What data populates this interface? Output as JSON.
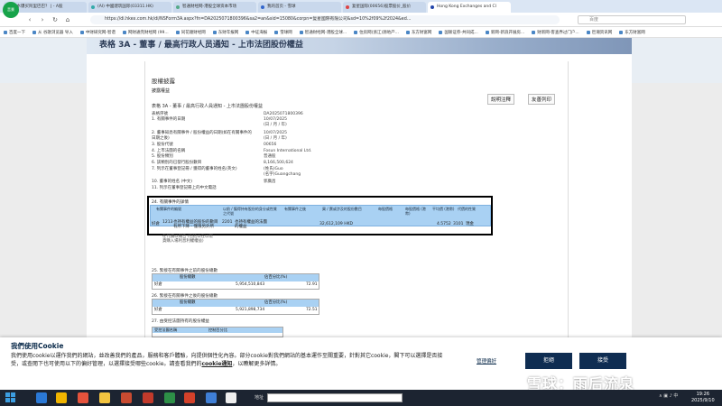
{
  "browser": {
    "badge": "音景",
    "tabs": [
      "北水爆买阿里巴巴？ | - A股",
      "(AI) 中國建筑国际(03311.HK)",
      "智通财经网-港股全球资本市场",
      "我的首页 - 雪球",
      "复星国际(00656)股票股价_股价",
      "Hong Kong Exchanges and Cl"
    ],
    "url": "https://di.hkex.com.hk/di/NSForm3A.aspx?fn=DA2025071800396&sa2=an&sid=15080&corpn=复星國際有限公司&sd=10%2f09%2f2024&ed...",
    "search_placeholder": "百度",
    "bookmarks": [
      "百度一下",
      "从 谷歌浏览器 导入",
      "中财研究网-智谱",
      "网财通完财经网 (99...",
      "同花顺财经网",
      "东财年报网",
      "中证海报",
      "雪球网",
      "智通财经网-港股全球...",
      "住房网(浙江)源地产...",
      "东方财富网",
      "国联证券-共同成...",
      "新网-新浪开展房...",
      "财新网-客查界过门户...",
      "巨潮资讯网",
      "东方财富网"
    ]
  },
  "page": {
    "banner_title": "表格 3A - 董事 / 最高行政人员通知 - 上市法团股份權益",
    "header": "股權披露",
    "subheader": "披露權益",
    "notes_button": "說明注釋",
    "print_button": "友善列印",
    "form_title": "表格 3A - 董事 / 最高行政人員通知 - 上市法團股份權益",
    "fields": [
      {
        "label": "表格序號",
        "value": "DA2025071800396"
      },
      {
        "label": "1. 有關事件的日期",
        "value": "10/07/2025"
      },
      {
        "label": "",
        "value": "(日 / 月 / 年)"
      },
      {
        "label": "2. 董事知悉有關事件 / 股份權益的日期(如在有關事件的",
        "value": "10/07/2025"
      },
      {
        "label": "日期之後)",
        "value": "(日 / 月 / 年)"
      },
      {
        "label": "3. 股份代號",
        "value": "00656"
      },
      {
        "label": "4. 上市法團的名稱",
        "value": "Fosun International Ltd."
      },
      {
        "label": "5. 股份類別",
        "value": "普通股"
      },
      {
        "label": "6. 該類別的已發行股份數目",
        "value": "8,166,500,624"
      },
      {
        "label": "7. 列示在董事登記冊 / 獲得的董事的姓名(英文)",
        "value": "(姓氏)Guo"
      },
      {
        "label": "",
        "value": "(名字)Guangchang"
      },
      {
        "label": "10. 董事的姓名 (中文)",
        "value": "郭廣昌"
      },
      {
        "label": "11. 列示在董事登記冊上的中文電話",
        "value": ""
      }
    ],
    "section24": {
      "title": "24. 有關事件的詳情",
      "headers": [
        "有關事件的編號",
        "以前 / 獲得持有股份的身分或性質之代號",
        "有關事件之後",
        "買 / 賣或涉及的股份數目",
        "每股價格",
        "每股價格 (港幣)",
        "平均價 (港幣)",
        "代價的性質",
        "現價"
      ],
      "row": [
        "好倉",
        "1213",
        "也持有權益的股份的數目有所下降 - 僅限另外所",
        "2201",
        "也持有權益的法團的權益",
        "32,612,109 HKD",
        "4.5752",
        "3101",
        "現金"
      ],
      "note": "在代價以報告 (包括以在以現貨購入場利息利權權益)"
    },
    "section25": {
      "title": "25. 緊接在有關事件之前的股份總數",
      "h1": "股份總數",
      "h2": "佔百分比(%)",
      "label": "好倉",
      "shares": "5,954,510,843",
      "percent": "72.91"
    },
    "section26": {
      "title": "26. 緊接在有關事件之後的股份總數",
      "h1": "股份總數",
      "h2": "佔百分比(%)",
      "label": "好倉",
      "shares": "5,921,898,734",
      "percent": "72.51"
    },
    "section27": {
      "title": "27. 由受控法團持有的股份權益",
      "h1": "受控法團名稱",
      "h2": "控制百分比"
    }
  },
  "cookie": {
    "title": "我們使用Cookie",
    "text": "我們使用cookie以運作我們的網站，並改善我們的產品，服務和客戶體驗，向提供個性化內容。部分cookie對我們網站的基本運作至關重要，針對其它cookie，閣下可以選擇是否接受，或查閱下也可使用以下的偏好管理，以選擇接受哪些cookie。請查看我們的",
    "link": "cookie通知",
    "text_end": "，以瞭解更多詳情。",
    "settings": "管理偏好",
    "reject": "拒絕",
    "accept": "接受"
  },
  "watermark": "雪球：雨后流泉",
  "taskbar": {
    "address_label": "地址",
    "time": "19:26",
    "date": "2025/9/10"
  }
}
